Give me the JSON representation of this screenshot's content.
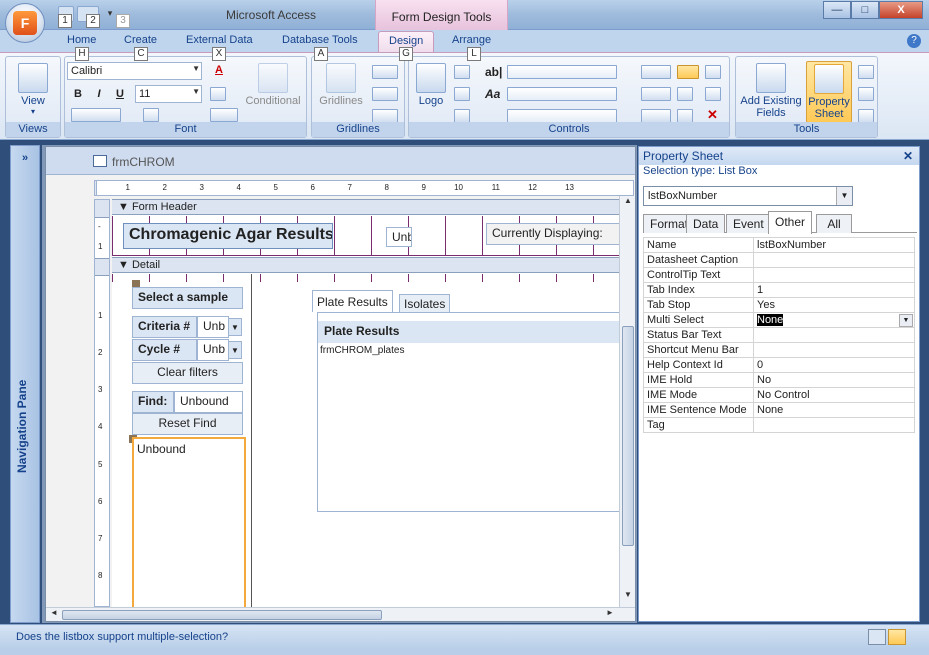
{
  "app": {
    "title": "Microsoft Access",
    "context_title": "Form Design Tools",
    "minimize": "—",
    "maximize": "□",
    "close": "X"
  },
  "office_button": {
    "letter": "F"
  },
  "qat": {
    "items": [
      "1",
      "2",
      "3"
    ]
  },
  "keytips": {
    "home": "H",
    "create": "C",
    "external": "X",
    "database": "A",
    "design": "G",
    "arrange": "L"
  },
  "tabs": [
    {
      "label": "Home"
    },
    {
      "label": "Create"
    },
    {
      "label": "External Data"
    },
    {
      "label": "Database Tools"
    },
    {
      "label": "Design",
      "active": true
    },
    {
      "label": "Arrange"
    }
  ],
  "ribbon": {
    "views": {
      "label": "Views",
      "view_button": "View"
    },
    "font": {
      "label": "Font",
      "font_name": "Calibri",
      "font_size": "11",
      "bold": "B",
      "italic": "I",
      "underline": "U",
      "font_color_glyph": "A",
      "conditional": "Conditional"
    },
    "gridlines": {
      "label": "Gridlines",
      "button": "Gridlines"
    },
    "controls": {
      "label": "Controls",
      "logo": "Logo",
      "textbox_glyph": "ab|",
      "label_glyph": "Aa"
    },
    "tools": {
      "label": "Tools",
      "add_fields": "Add Existing Fields",
      "property_sheet": "Property Sheet"
    }
  },
  "nav_pane": {
    "label": "Navigation Pane",
    "toggle": "»"
  },
  "form": {
    "tab_title": "frmCHROM",
    "sections": {
      "header": "Form Header",
      "detail": "Detail"
    },
    "header_title": "Chromagenic Agar Results",
    "header_unbound": "Unb",
    "header_currently": "Currently Displaying:",
    "select_sample": "Select a sample",
    "criteria_label": "Criteria #",
    "criteria_value": "Unb",
    "cycle_label": "Cycle #",
    "cycle_value": "Unb",
    "clear_filters": "Clear filters",
    "find_label": "Find:",
    "find_value": "Unbound",
    "reset_find": "Reset Find",
    "listbox_value": "Unbound",
    "tab_plate": "Plate Results",
    "tab_isolates": "Isolates",
    "subform_header": "Plate Results",
    "subform_name": "frmCHROM_plates",
    "ruler_marks": [
      "1",
      "2",
      "3",
      "4",
      "5",
      "6",
      "7",
      "8",
      "9",
      "10",
      "11",
      "12",
      "13"
    ],
    "vruler_marks": [
      "1",
      "1",
      "2",
      "3",
      "4",
      "5",
      "6",
      "7",
      "8"
    ]
  },
  "property_sheet": {
    "title": "Property Sheet",
    "selection_type": "Selection type:  List Box",
    "selected_object": "lstBoxNumber",
    "tabs": [
      "Format",
      "Data",
      "Event",
      "Other",
      "All"
    ],
    "active_tab": "Other",
    "properties": [
      {
        "name": "Name",
        "value": "lstBoxNumber"
      },
      {
        "name": "Datasheet Caption",
        "value": ""
      },
      {
        "name": "ControlTip Text",
        "value": ""
      },
      {
        "name": "Tab Index",
        "value": "1"
      },
      {
        "name": "Tab Stop",
        "value": "Yes"
      },
      {
        "name": "Multi Select",
        "value": "None",
        "selected": true
      },
      {
        "name": "Status Bar Text",
        "value": ""
      },
      {
        "name": "Shortcut Menu Bar",
        "value": ""
      },
      {
        "name": "Help Context Id",
        "value": "0"
      },
      {
        "name": "IME Hold",
        "value": "No"
      },
      {
        "name": "IME Mode",
        "value": "No Control"
      },
      {
        "name": "IME Sentence Mode",
        "value": "None"
      },
      {
        "name": "Tag",
        "value": ""
      }
    ]
  },
  "status_bar": {
    "text": "Does the listbox support multiple-selection?"
  }
}
